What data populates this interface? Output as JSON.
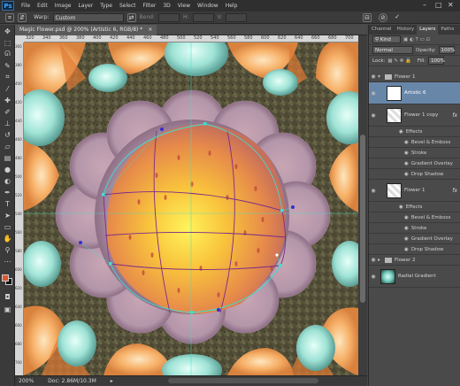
{
  "menu": {
    "logo": "Ps",
    "items": [
      "File",
      "Edit",
      "Image",
      "Layer",
      "Type",
      "Select",
      "Filter",
      "3D",
      "View",
      "Window",
      "Help"
    ],
    "window_controls": [
      "–",
      "□",
      "✕"
    ]
  },
  "options": {
    "warp_label": "Warp:",
    "warp_value": "Custom",
    "bend_label": "Bend:",
    "h_label": "H:",
    "v_label": "V:",
    "confirm_icons": [
      "⊟",
      "⊘",
      "✓"
    ]
  },
  "document": {
    "tab_title": "Magic Flower.psd @ 200% (Artistic 6, RGB/8) *",
    "close_glyph": "×",
    "ruler_h": [
      "320",
      "340",
      "360",
      "380",
      "400",
      "420",
      "440",
      "460",
      "480",
      "500",
      "520",
      "540",
      "560",
      "580",
      "600",
      "620",
      "640",
      "660",
      "680",
      "700"
    ],
    "ruler_v": [
      "360",
      "380",
      "400",
      "420",
      "440",
      "460",
      "480",
      "500",
      "520",
      "540",
      "560",
      "580",
      "600",
      "620",
      "640",
      "660",
      "680",
      "700"
    ]
  },
  "status": {
    "zoom": "200%",
    "doc": "Doc: 2.86M/10.3M",
    "arrow": "▸"
  },
  "panel": {
    "tabs": [
      "Channel",
      "History",
      "Layers",
      "Paths"
    ],
    "active_tab": "Layers",
    "filter_label": "Kind",
    "blend_mode": "Normal",
    "opacity_label": "Opacity:",
    "opacity_value": "100%",
    "lock_label": "Lock:",
    "fill_label": "Fill:",
    "fill_value": "100%",
    "layers": [
      {
        "name": "Flower 1",
        "type": "group-open"
      },
      {
        "name": "Artistic 6",
        "type": "layer",
        "selected": true
      },
      {
        "name": "Flower 1 copy",
        "type": "layer",
        "fx": "fx"
      },
      {
        "name": "Effects",
        "type": "effects"
      },
      {
        "name": "Bevel & Emboss",
        "type": "effect"
      },
      {
        "name": "Stroke",
        "type": "effect"
      },
      {
        "name": "Gradient Overlay",
        "type": "effect"
      },
      {
        "name": "Drop Shadow",
        "type": "effect"
      },
      {
        "name": "Flower 1",
        "type": "layer",
        "fx": "fx"
      },
      {
        "name": "Effects",
        "type": "effects"
      },
      {
        "name": "Bevel & Emboss",
        "type": "effect"
      },
      {
        "name": "Stroke",
        "type": "effect"
      },
      {
        "name": "Gradient Overlay",
        "type": "effect"
      },
      {
        "name": "Drop Shadow",
        "type": "effect"
      },
      {
        "name": "Flower 2",
        "type": "group"
      },
      {
        "name": "Radial Gradient",
        "type": "layer"
      }
    ]
  },
  "colors": {
    "accent_selection": "#6886a8",
    "foreground": "#e0562f",
    "background": "#111111",
    "guide": "#3ee0d0",
    "warp_grid": "#7a2a8a"
  }
}
